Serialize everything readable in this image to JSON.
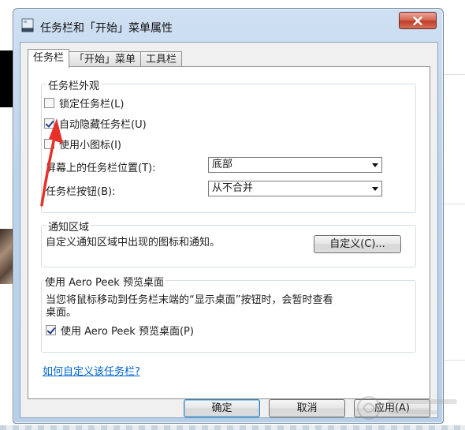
{
  "window": {
    "title": "任务栏和「开始」菜单属性"
  },
  "tabs": [
    {
      "label": "任务栏",
      "active": true
    },
    {
      "label": "「开始」菜单",
      "active": false
    },
    {
      "label": "工具栏",
      "active": false
    }
  ],
  "appearance": {
    "legend": "任务栏外观",
    "lock_taskbar": {
      "label": "锁定任务栏(L)",
      "checked": false
    },
    "auto_hide": {
      "label": "自动隐藏任务栏(U)",
      "checked": true
    },
    "small_icons": {
      "label": "使用小图标(I)",
      "checked": false
    },
    "location": {
      "label": "屏幕上的任务栏位置(T):",
      "value": "底部"
    },
    "buttons": {
      "label": "任务栏按钮(B):",
      "value": "从不合并"
    }
  },
  "notification": {
    "legend": "通知区域",
    "description": "自定义通知区域中出现的图标和通知。",
    "customize_button": "自定义(C)..."
  },
  "aero_peek": {
    "legend": "使用 Aero Peek 预览桌面",
    "description_line1": "当您将鼠标移动到任务栏末端的“显示桌面”按钮时，会暂时查看",
    "description_line2": "桌面。",
    "checkbox": {
      "label": "使用 Aero Peek 预览桌面(P)",
      "checked": true
    }
  },
  "help_link": "如何自定义该任务栏?",
  "footer": {
    "ok": "确定",
    "cancel": "取消",
    "apply": "应用(A)"
  },
  "colors": {
    "accent_link": "#0066cc",
    "annotation_arrow": "#e8302a",
    "close_button": "#c23d28"
  }
}
